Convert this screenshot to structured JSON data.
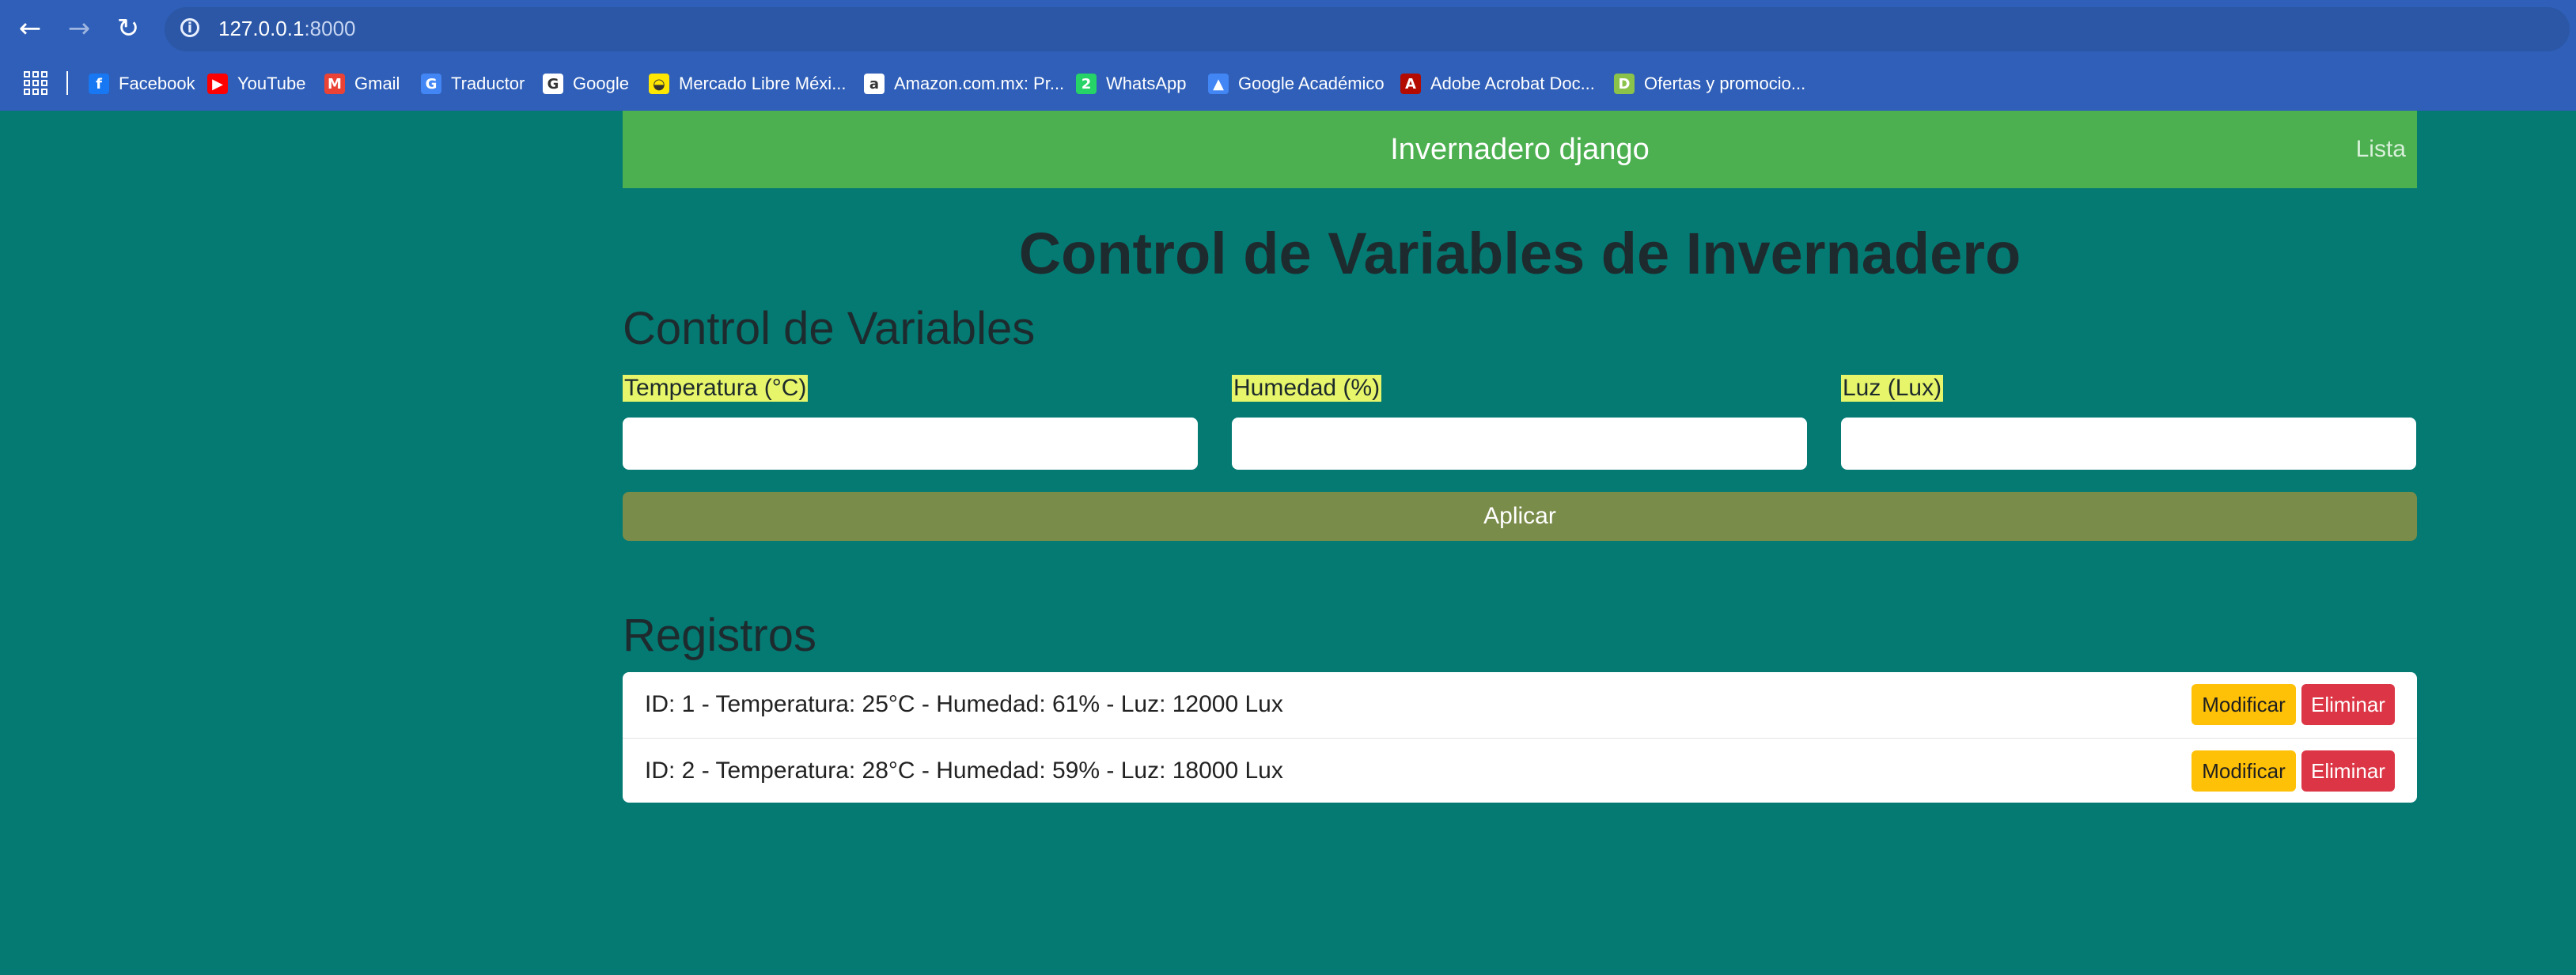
{
  "browser": {
    "url_host": "127.0.0.1",
    "url_port": ":8000"
  },
  "bookmarks": [
    {
      "label": "Facebook",
      "icon": "facebook-icon",
      "color": "#1877f2",
      "glyph": "f"
    },
    {
      "label": "YouTube",
      "icon": "youtube-icon",
      "color": "#ff0000",
      "glyph": "▶"
    },
    {
      "label": "Gmail",
      "icon": "gmail-icon",
      "color": "#ea4335",
      "glyph": "M"
    },
    {
      "label": "Traductor",
      "icon": "translate-icon",
      "color": "#4285f4",
      "glyph": "G"
    },
    {
      "label": "Google",
      "icon": "google-icon",
      "color": "#ffffff",
      "glyph": "G"
    },
    {
      "label": "Mercado Libre Méxi...",
      "icon": "mercadolibre-icon",
      "color": "#ffe600",
      "glyph": "◒"
    },
    {
      "label": "Amazon.com.mx: Pr...",
      "icon": "amazon-icon",
      "color": "#ffffff",
      "glyph": "a"
    },
    {
      "label": "WhatsApp",
      "icon": "whatsapp-icon",
      "color": "#25d366",
      "glyph": "2"
    },
    {
      "label": "Google Académico",
      "icon": "scholar-icon",
      "color": "#4285f4",
      "glyph": "▲"
    },
    {
      "label": "Adobe Acrobat Doc...",
      "icon": "acrobat-icon",
      "color": "#b30b00",
      "glyph": "A"
    },
    {
      "label": "Ofertas y promocio...",
      "icon": "offers-icon",
      "color": "#8bc34a",
      "glyph": "D"
    }
  ],
  "navbar": {
    "brand": "Invernadero django",
    "link": "Lista"
  },
  "page": {
    "title": "Control de Variables de Invernadero",
    "form_heading": "Control de Variables",
    "fields": [
      {
        "label": "Temperatura (°C)",
        "value": ""
      },
      {
        "label": "Humedad (%)",
        "value": ""
      },
      {
        "label": "Luz (Lux)",
        "value": ""
      }
    ],
    "apply_label": "Aplicar",
    "records_heading": "Registros",
    "records": [
      {
        "text": "ID: 1 - Temperatura: 25°C - Humedad: 61% - Luz: 12000 Lux",
        "modify": "Modificar",
        "delete": "Eliminar"
      },
      {
        "text": "ID: 2 - Temperatura: 28°C - Humedad: 59% - Luz: 18000 Lux",
        "modify": "Modificar",
        "delete": "Eliminar"
      }
    ]
  },
  "colors": {
    "page_bg": "#047a73",
    "navbar": "#4caf50",
    "apply": "#7a8c4a",
    "label_highlight": "#e6f56a",
    "modify": "#ffc107",
    "delete": "#dc3545"
  }
}
